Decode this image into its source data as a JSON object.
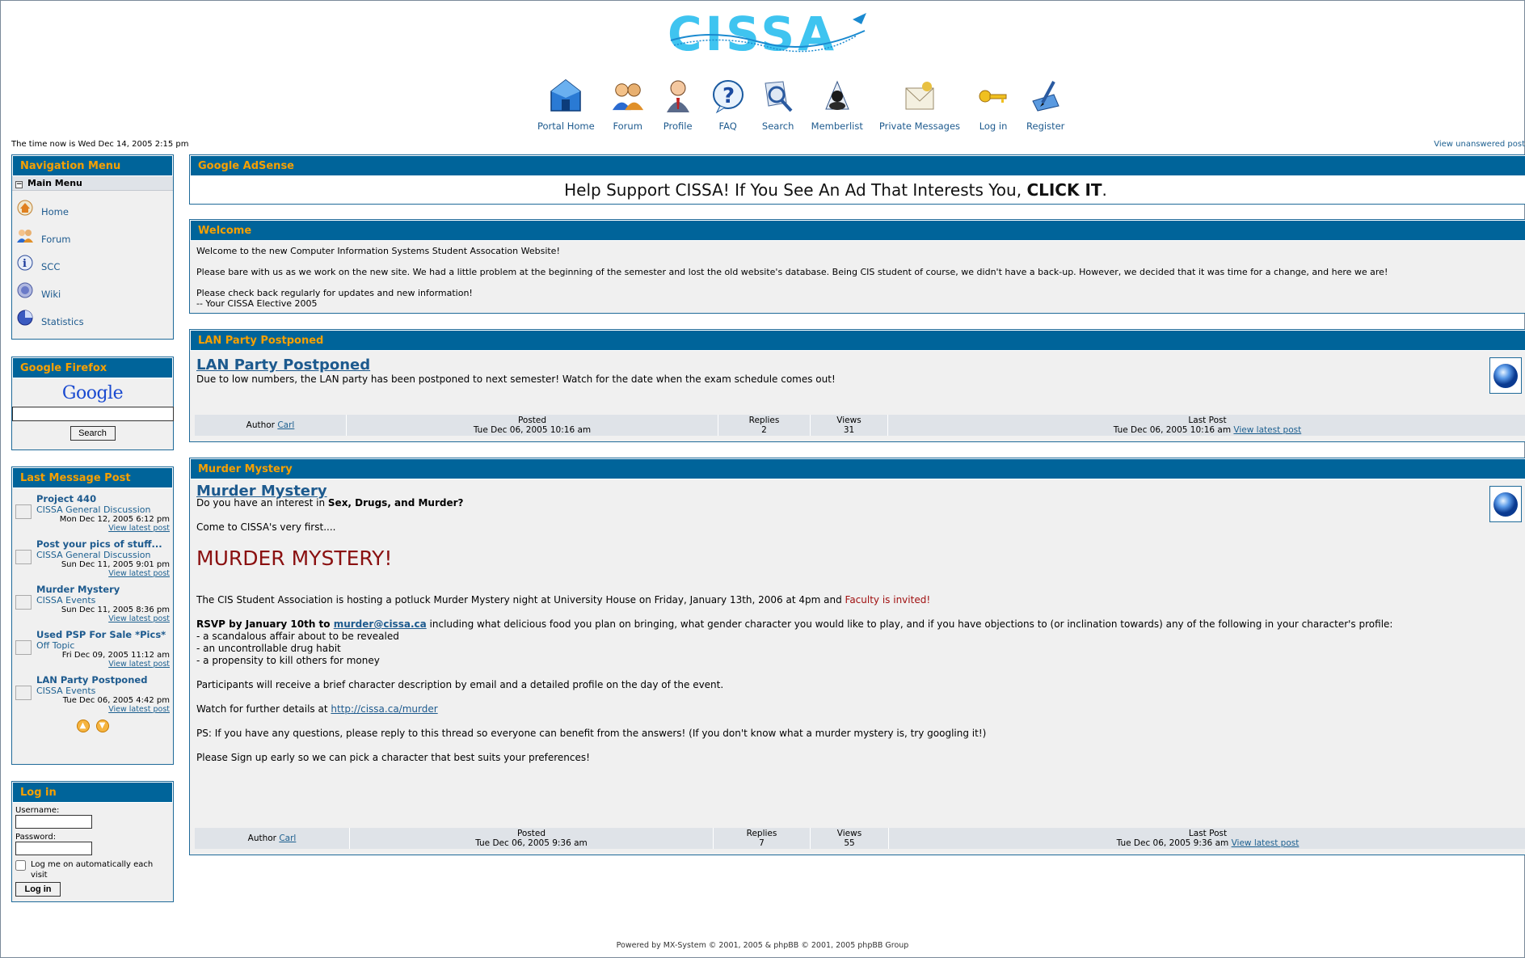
{
  "header": {
    "logo_text": "CISSA",
    "nav": [
      {
        "label": "Portal Home",
        "icon": "house-icon"
      },
      {
        "label": "Forum",
        "icon": "users-icon"
      },
      {
        "label": "Profile",
        "icon": "person-icon"
      },
      {
        "label": "FAQ",
        "icon": "question-icon"
      },
      {
        "label": "Search",
        "icon": "search-icon"
      },
      {
        "label": "Memberlist",
        "icon": "memberlist-icon"
      },
      {
        "label": "Private Messages",
        "icon": "envelope-icon"
      },
      {
        "label": "Log in",
        "icon": "key-icon"
      },
      {
        "label": "Register",
        "icon": "register-icon"
      }
    ],
    "time_now": "The time now is Wed Dec 14, 2005 2:15 pm",
    "unanswered": "View unanswered post"
  },
  "sidebar": {
    "nav_title": "Navigation Menu",
    "main_menu": "Main Menu",
    "items": [
      {
        "label": "Home",
        "icon": "home-icon"
      },
      {
        "label": "Forum",
        "icon": "forum-icon"
      },
      {
        "label": "SCC",
        "icon": "info-icon"
      },
      {
        "label": "Wiki",
        "icon": "wiki-icon"
      },
      {
        "label": "Statistics",
        "icon": "statistics-icon"
      }
    ],
    "google_title": "Google Firefox",
    "google_logo": "Google",
    "search_btn": "Search",
    "lastmsg_title": "Last Message Post",
    "lastmsg": [
      {
        "title": "Project 440",
        "forum": "CISSA General Discussion",
        "date": "Mon Dec 12, 2005 6:12 pm",
        "view": "View latest post"
      },
      {
        "title": "Post your pics of stuff...",
        "forum": "CISSA General Discussion",
        "date": "Sun Dec 11, 2005 9:01 pm",
        "view": "View latest post"
      },
      {
        "title": "Murder Mystery",
        "forum": "CISSA Events",
        "date": "Sun Dec 11, 2005 8:36 pm",
        "view": "View latest post"
      },
      {
        "title": "Used PSP For Sale *Pics*",
        "forum": "Off Topic",
        "date": "Fri Dec 09, 2005 11:12 am",
        "view": "View latest post"
      },
      {
        "title": "LAN Party Postponed",
        "forum": "CISSA Events",
        "date": "Tue Dec 06, 2005 4:42 pm",
        "view": "View latest post"
      }
    ],
    "login_title": "Log in",
    "username_label": "Username:",
    "password_label": "Password:",
    "remember_label": "Log me on automatically each visit",
    "login_btn": "Log in"
  },
  "main": {
    "adsense_title": "Google AdSense",
    "adsense_text_pre": "Help Support CISSA! If You See An Ad That Interests You, ",
    "adsense_text_bold": "CLICK IT",
    "adsense_text_post": ".",
    "welcome_title": "Welcome",
    "welcome_lines": [
      "Welcome to the new Computer Information Systems Student Assocation Website!",
      "Please bare with us as we work on the new site. We had a little problem at the beginning of the semester and lost the old website's database. Being CIS student of course, we didn't have a back-up. However, we decided that it was time for a change, and here we are!",
      "Please check back regularly for updates and new information!",
      "-- Your CISSA Elective 2005"
    ],
    "lan": {
      "head": "LAN Party Postponed",
      "title": "LAN Party Postponed",
      "text": "Due to low numbers, the LAN party has been postponed to next semester! Watch for the date when the exam schedule comes out!",
      "author_label": "Author",
      "author": "Carl",
      "posted_label": "Posted",
      "posted": "Tue Dec 06, 2005 10:16 am",
      "replies_label": "Replies",
      "replies": "2",
      "views_label": "Views",
      "views": "31",
      "lastpost_label": "Last Post",
      "lastpost": "Tue Dec 06, 2005 10:16 am",
      "view_latest": "View latest post"
    },
    "murder": {
      "head": "Murder Mystery",
      "title": "Murder Mystery",
      "intro_pre": "Do you have an interest in ",
      "intro_bold": "Sex, Drugs, and Murder?",
      "come": "Come to CISSA's very first....",
      "big": "MURDER MYSTERY!",
      "hosting_pre": "The CIS Student Association is hosting a potluck Murder Mystery night at University House on Friday, January 13th, 2006 at 4pm and ",
      "hosting_red": "Faculty is invited!",
      "rsvp_bold": "RSVP by January 10th to ",
      "rsvp_email": "murder@cissa.ca",
      "rsvp_rest": " including what delicious food you plan on bringing, what gender character you would like to play, and if you have objections to (or inclination towards) any of the following in your character's profile:",
      "list": [
        "- a scandalous affair about to be revealed",
        "- an uncontrollable drug habit",
        "- a propensity to kill others for money"
      ],
      "participants": "Participants will receive a brief character description by email and a detailed profile on the day of the event.",
      "watch_pre": "Watch for further details at ",
      "watch_link": "http://cissa.ca/murder",
      "ps": "PS: If you have any questions, please reply to this thread so everyone can benefit from the answers! (If you don't know what a murder mystery is, try googling it!)",
      "signup": "Please Sign up early so we can pick a character that best suits your preferences!",
      "author_label": "Author",
      "author": "Carl",
      "posted_label": "Posted",
      "posted": "Tue Dec 06, 2005 9:36 am",
      "replies_label": "Replies",
      "replies": "7",
      "views_label": "Views",
      "views": "55",
      "lastpost_label": "Last Post",
      "lastpost": "Tue Dec 06, 2005 9:36 am",
      "view_latest": "View latest post"
    }
  },
  "footer": "Powered by MX-System © 2001, 2005 & phpBB © 2001, 2005 phpBB Group",
  "colors": {
    "header_blue": "#00649a",
    "header_text": "#f7a000",
    "link": "#1d5a8e",
    "logo": "#3fc4f0"
  }
}
